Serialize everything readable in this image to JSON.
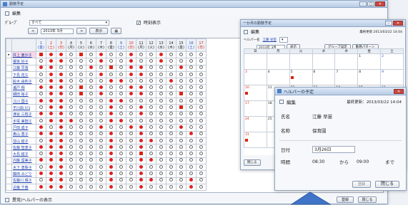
{
  "main": {
    "title": "勤務予定",
    "edit_label": "編集",
    "group_label": "ｸﾞﾙｰﾌﾟ",
    "group_value": "すべて",
    "month_value": "2013年 3月",
    "show_btn": "表示",
    "nav_next": ">",
    "nav_prev": "<",
    "holiday_label": "時刻表示",
    "footer_check": "異常/ヘルパーの表示",
    "ok_btn": "登録",
    "close_btn": "閉じる",
    "days": [
      {
        "n": "1",
        "w": "(金)",
        "c": "blu"
      },
      {
        "n": "2",
        "w": "(土)",
        "c": "red"
      },
      {
        "n": "3",
        "w": "(日)",
        "c": "red"
      },
      {
        "n": "4",
        "w": "(月)",
        "c": ""
      },
      {
        "n": "5",
        "w": "(火)",
        "c": ""
      },
      {
        "n": "6",
        "w": "(水)",
        "c": ""
      },
      {
        "n": "7",
        "w": "(木)",
        "c": ""
      },
      {
        "n": "8",
        "w": "(金)",
        "c": ""
      },
      {
        "n": "9",
        "w": "(土)",
        "c": "blu"
      },
      {
        "n": "10",
        "w": "(日)",
        "c": "red"
      },
      {
        "n": "11",
        "w": "(月)",
        "c": ""
      },
      {
        "n": "12",
        "w": "(火)",
        "c": ""
      },
      {
        "n": "13",
        "w": "(水)",
        "c": ""
      },
      {
        "n": "14",
        "w": "(木)",
        "c": ""
      },
      {
        "n": "15",
        "w": "(金)",
        "c": ""
      },
      {
        "n": "16",
        "w": "(土)",
        "c": "blu"
      },
      {
        "n": "17",
        "w": "(日)",
        "c": "red"
      }
    ],
    "staff": [
      "井上 亜沙子",
      "榎坂 好子",
      "江藤 早苗",
      "下島 花江",
      "鈴木 由利子",
      "瀬戸 翔",
      "細田 裕子",
      "江川 国子",
      "平川由 ｶﾂﾖ",
      "津谷 三枝子",
      "手塚 美智江",
      "戸田 成子",
      "奥山 恵子",
      "窪山 結子",
      "佐藤 智恵子",
      "大島 結子",
      "内籐 留美子",
      "木下 恵梨子",
      "藤田 みどり",
      "佐藤川 晴子",
      "近藤 千春"
    ],
    "pattern": [
      "RDDORODOODOODOOOO",
      "ODDOOODOODOODOOOO",
      "DDOOODOSODDOOODOO",
      "ODDOOODOODDOOOOOO",
      "ODDOOOODDOOOODOOO",
      "DDDOSODOODDOOOOOO",
      "ODDOSODOODDOOOSOO",
      "DDDOOOODDOOOOOOOO",
      "ODDOOOODOODOOOSOO",
      "DDDOOOODOODOOOOOO",
      "ODDDOOODDOOOOOOOO",
      "DODOOODOODDOOODOO",
      "DDDOOOODOODOOOODO",
      "ODDOOOODOODDOOOOO",
      "DDDOOOODOODOOOOOO",
      "ODDOOOODOOSOOOOOO",
      "DDDOOOODOODDOOOOO",
      "ODDOOOODOODOOOOOO",
      "DDDOOOODOODOOOOOO",
      "ODDOOOODOODDOOODO",
      "DDDOOOODOODOOOODO"
    ]
  },
  "cal": {
    "title": "一か月の勤務予定",
    "edit_label": "編集",
    "updated": "最終更新 2013/03/22 14:04",
    "helper_label": "ヘルパー名",
    "helper_name": "江藤 早苗",
    "month_value": "2013年 3月",
    "show_btn": "表示",
    "group_btn": "グループ設定",
    "pattern_btn": "勤務パターン",
    "week": [
      "日",
      "月",
      "火",
      "水",
      "木",
      "金",
      "土"
    ],
    "days": [
      "",
      "",
      "",
      "",
      "",
      "1",
      "2",
      "3",
      "4",
      "5",
      "6",
      "7",
      "8",
      "9",
      "10",
      "11",
      "12",
      "13",
      "14",
      "15",
      "16",
      "17",
      "18",
      "19",
      "20",
      "21",
      "22",
      "23",
      "24",
      "25",
      "26",
      "27",
      "28",
      "29",
      "30",
      "31",
      ""
    ],
    "marks": [
      5,
      10,
      19,
      26,
      31
    ],
    "footer_btn": "閉じる"
  },
  "dlg": {
    "title": "ヘルパーの予定",
    "edit_label": "編集",
    "updated": "最終更新：2013/03/22 14:04",
    "f_name_label": "氏名",
    "f_name": "江藤 早苗",
    "f_title_label": "名称",
    "f_title": "保育園",
    "f_date_label": "日付",
    "f_date": "3月26日",
    "f_time_label": "時間",
    "f_from": "08:30",
    "f_mid": "から",
    "f_to": "09:00",
    "f_end": "まで",
    "reg_btn": "登録",
    "close_btn": "閉じる"
  }
}
